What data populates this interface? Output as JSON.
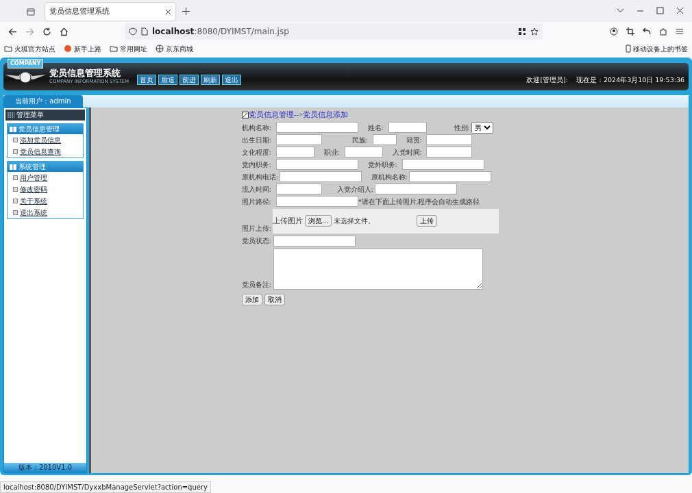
{
  "browser": {
    "tab_title": "党员信息管理系统",
    "url_host": "localhost",
    "url_path": ":8080/DYIMST/main.jsp",
    "bookmarks": [
      "火狐官方站点",
      "新手上路",
      "常用网址",
      "京东商城"
    ],
    "mobile_bookmarks": "移动设备上的书签"
  },
  "header": {
    "company": "COMPANY",
    "title": "党员信息管理系统",
    "subtitle": "COMPANY INFORMATION SYSTEM",
    "nav": [
      "首页",
      "后退",
      "前进",
      "刷新",
      "退出"
    ],
    "welcome": "欢迎[管理员]:",
    "clock": "现在是：2024年3月10日 19:53:36"
  },
  "user_bar": {
    "current_user": "当前用户：admin"
  },
  "sidebar": {
    "menu_title": "管理菜单",
    "groups": [
      {
        "title": "党员信息管理",
        "items": [
          "添加党员信息",
          "党员信息查询"
        ]
      },
      {
        "title": "系统管理",
        "items": [
          "用户管理",
          "修改密码",
          "关于系统",
          "退出系统"
        ]
      }
    ],
    "version": "版本：2010V1.0"
  },
  "form": {
    "breadcrumb": "党员信息管理-->党员信息添加",
    "rows": [
      {
        "fields": [
          {
            "label": "机构名称:",
            "kind": "text"
          },
          {
            "label": "姓名:",
            "kind": "text"
          },
          {
            "label": "性别:",
            "kind": "select",
            "value": "男"
          }
        ]
      },
      {
        "fields": [
          {
            "label": "出生日期:",
            "kind": "text"
          },
          {
            "label": "民族:",
            "kind": "text"
          },
          {
            "label": "籍贯:",
            "kind": "text"
          }
        ]
      },
      {
        "fields": [
          {
            "label": "文化程度:",
            "kind": "text"
          },
          {
            "label": "职业:",
            "kind": "text"
          },
          {
            "label": "入党时间:",
            "kind": "text"
          }
        ]
      },
      {
        "fields": [
          {
            "label": "党内职务:",
            "kind": "text"
          },
          {
            "label": "党外职务:",
            "kind": "text"
          }
        ]
      },
      {
        "fields": [
          {
            "label": "原机构电话:",
            "kind": "text"
          },
          {
            "label": "原机构名称:",
            "kind": "text"
          }
        ]
      },
      {
        "fields": [
          {
            "label": "流入时间:",
            "kind": "text"
          },
          {
            "label": "入党介绍人:",
            "kind": "text"
          }
        ]
      },
      {
        "fields": [
          {
            "label": "照片路径:",
            "kind": "text"
          }
        ],
        "note": "*请在下面上传照片,程序会自动生成路径"
      }
    ],
    "upload": {
      "label": "照片上传:",
      "caption": "上传图片",
      "browse": "浏览...",
      "file_status": "未选择文件。",
      "button": "上传"
    },
    "status_label": "党员状态:",
    "remarks_label": "党员备注:",
    "buttons": [
      "添加",
      "取消"
    ]
  },
  "status_url": "localhost:8080/DYIMST/DyxxbManageServlet?action=query"
}
